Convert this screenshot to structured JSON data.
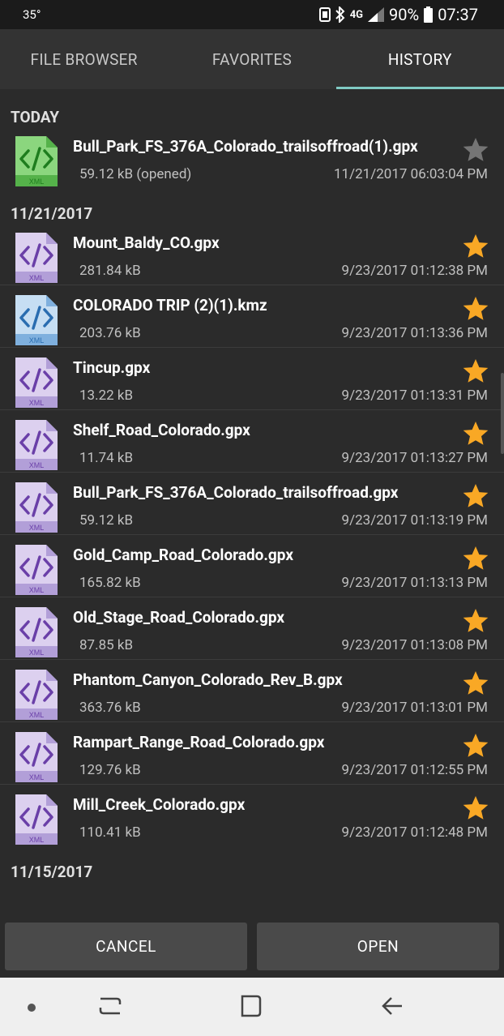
{
  "status_bar": {
    "temperature": "35°",
    "network": "4G",
    "battery": "90%",
    "time": "07:37"
  },
  "tabs": [
    {
      "label": "FILE BROWSER",
      "active": false
    },
    {
      "label": "FAVORITES",
      "active": false
    },
    {
      "label": "HISTORY",
      "active": true
    }
  ],
  "sections": [
    {
      "header": "TODAY",
      "items": [
        {
          "name": "Bull_Park_FS_376A_Colorado_trailsoffroad(1).gpx",
          "size": "59.12 kB (opened)",
          "date": "11/21/2017 06:03:04 PM",
          "icon": "xml-file-green-icon",
          "favorite": false
        }
      ]
    },
    {
      "header": "11/21/2017",
      "items": [
        {
          "name": "Mount_Baldy_CO.gpx",
          "size": "281.84 kB",
          "date": "9/23/2017 01:12:38 PM",
          "icon": "xml-file-purple-icon",
          "favorite": true
        },
        {
          "name": "COLORADO TRIP (2)(1).kmz",
          "size": "203.76 kB",
          "date": "9/23/2017 01:13:36 PM",
          "icon": "xml-file-blue-icon",
          "favorite": true
        },
        {
          "name": "Tincup.gpx",
          "size": "13.22 kB",
          "date": "9/23/2017 01:13:31 PM",
          "icon": "xml-file-purple-icon",
          "favorite": true
        },
        {
          "name": "Shelf_Road_Colorado.gpx",
          "size": "11.74 kB",
          "date": "9/23/2017 01:13:27 PM",
          "icon": "xml-file-purple-icon",
          "favorite": true
        },
        {
          "name": "Bull_Park_FS_376A_Colorado_trailsoffroad.gpx",
          "size": "59.12 kB",
          "date": "9/23/2017 01:13:19 PM",
          "icon": "xml-file-purple-icon",
          "favorite": true
        },
        {
          "name": "Gold_Camp_Road_Colorado.gpx",
          "size": "165.82 kB",
          "date": "9/23/2017 01:13:13 PM",
          "icon": "xml-file-purple-icon",
          "favorite": true
        },
        {
          "name": "Old_Stage_Road_Colorado.gpx",
          "size": "87.85 kB",
          "date": "9/23/2017 01:13:08 PM",
          "icon": "xml-file-purple-icon",
          "favorite": true
        },
        {
          "name": "Phantom_Canyon_Colorado_Rev_B.gpx",
          "size": "363.76 kB",
          "date": "9/23/2017 01:13:01 PM",
          "icon": "xml-file-purple-icon",
          "favorite": true
        },
        {
          "name": "Rampart_Range_Road_Colorado.gpx",
          "size": "129.76 kB",
          "date": "9/23/2017 01:12:55 PM",
          "icon": "xml-file-purple-icon",
          "favorite": true
        },
        {
          "name": "Mill_Creek_Colorado.gpx",
          "size": "110.41 kB",
          "date": "9/23/2017 01:12:48 PM",
          "icon": "xml-file-purple-icon",
          "favorite": true
        }
      ]
    },
    {
      "header": "11/15/2017",
      "items": []
    }
  ],
  "buttons": {
    "cancel": "CANCEL",
    "open": "OPEN"
  },
  "colors": {
    "accent": "#80cbc4",
    "star_gold": "#f9a825",
    "star_gray": "#757575",
    "xml_green": "#66bb6a",
    "xml_purple": "#d1c4e9",
    "xml_blue": "#b3d4f0"
  }
}
